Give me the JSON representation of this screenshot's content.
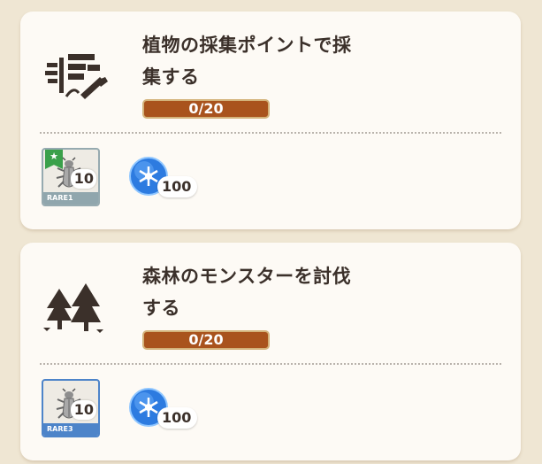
{
  "quests": [
    {
      "icon": "gathering-tools-icon",
      "title_line1": "植物の採集ポイントで採",
      "title_line2": "集する",
      "progress": {
        "current": 0,
        "total": 20,
        "label": "0/20"
      },
      "reward_item": {
        "icon": "beetle-icon",
        "count": "10",
        "rarity": "RARE1",
        "starred": true
      },
      "reward_currency": {
        "icon": "blue-crystal-icon",
        "amount": "100"
      }
    },
    {
      "icon": "forest-trees-icon",
      "title_line1": "森林のモンスターを討伐",
      "title_line2": "する",
      "progress": {
        "current": 0,
        "total": 20,
        "label": "0/20"
      },
      "reward_item": {
        "icon": "beetle-icon",
        "count": "10",
        "rarity": "RARE3",
        "starred": false
      },
      "reward_currency": {
        "icon": "blue-crystal-icon",
        "amount": "100"
      }
    }
  ],
  "colors": {
    "background": "#efe6d3",
    "card": "#fdfaf5",
    "progress_bar": "#a9531d",
    "progress_border": "#d3b27a",
    "rare1": "#90a6ad",
    "rare3": "#4d84c9",
    "star_ribbon": "#3aa04a",
    "text": "#3b302a"
  }
}
